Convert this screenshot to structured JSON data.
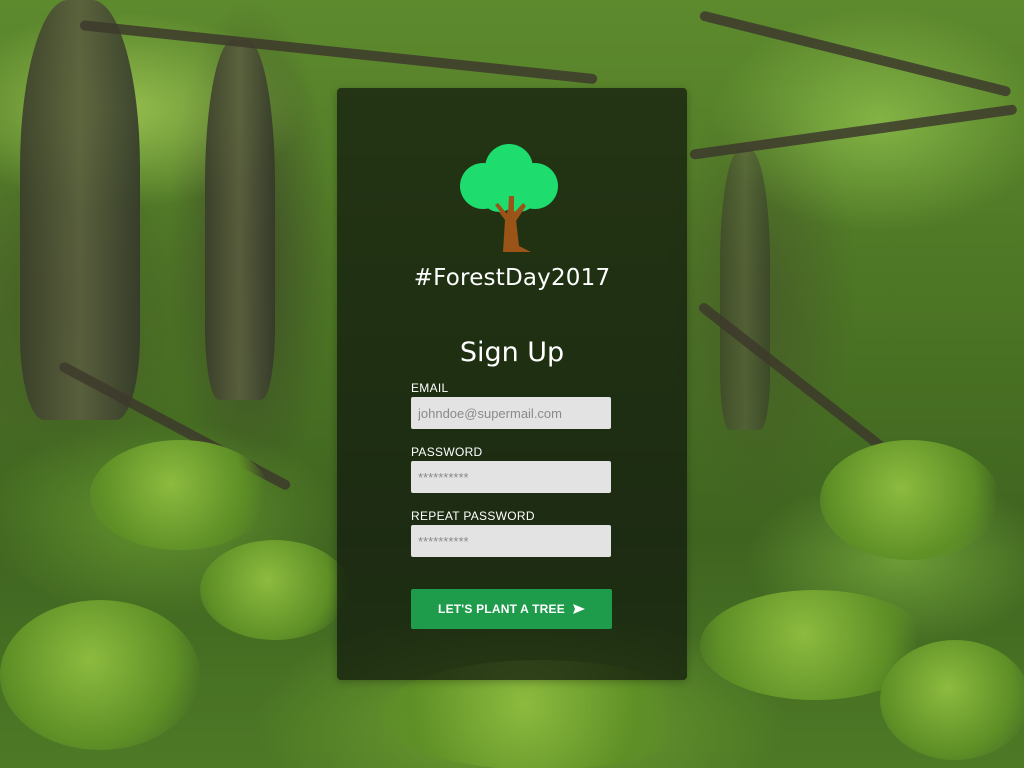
{
  "brand": {
    "hashtag": "#ForestDay2017"
  },
  "form": {
    "title": "Sign Up",
    "email": {
      "label": "EMAIL",
      "placeholder": "johndoe@supermail.com",
      "value": ""
    },
    "password": {
      "label": "PASSWORD",
      "placeholder": "**********",
      "value": ""
    },
    "repeat_password": {
      "label": "REPEAT PASSWORD",
      "placeholder": "**********",
      "value": ""
    },
    "submit": {
      "label": "LET'S PLANT A TREE",
      "icon": "send-arrow-icon"
    }
  },
  "icons": {
    "logo": "tree-icon"
  },
  "colors": {
    "card_background": "rgba(15,22,12,0.72)",
    "button": "#1e9b4b",
    "input_background": "#e3e3e3",
    "tree_canopy": "#1fdc6e",
    "tree_trunk": "#9a5418",
    "text": "#ffffff"
  }
}
